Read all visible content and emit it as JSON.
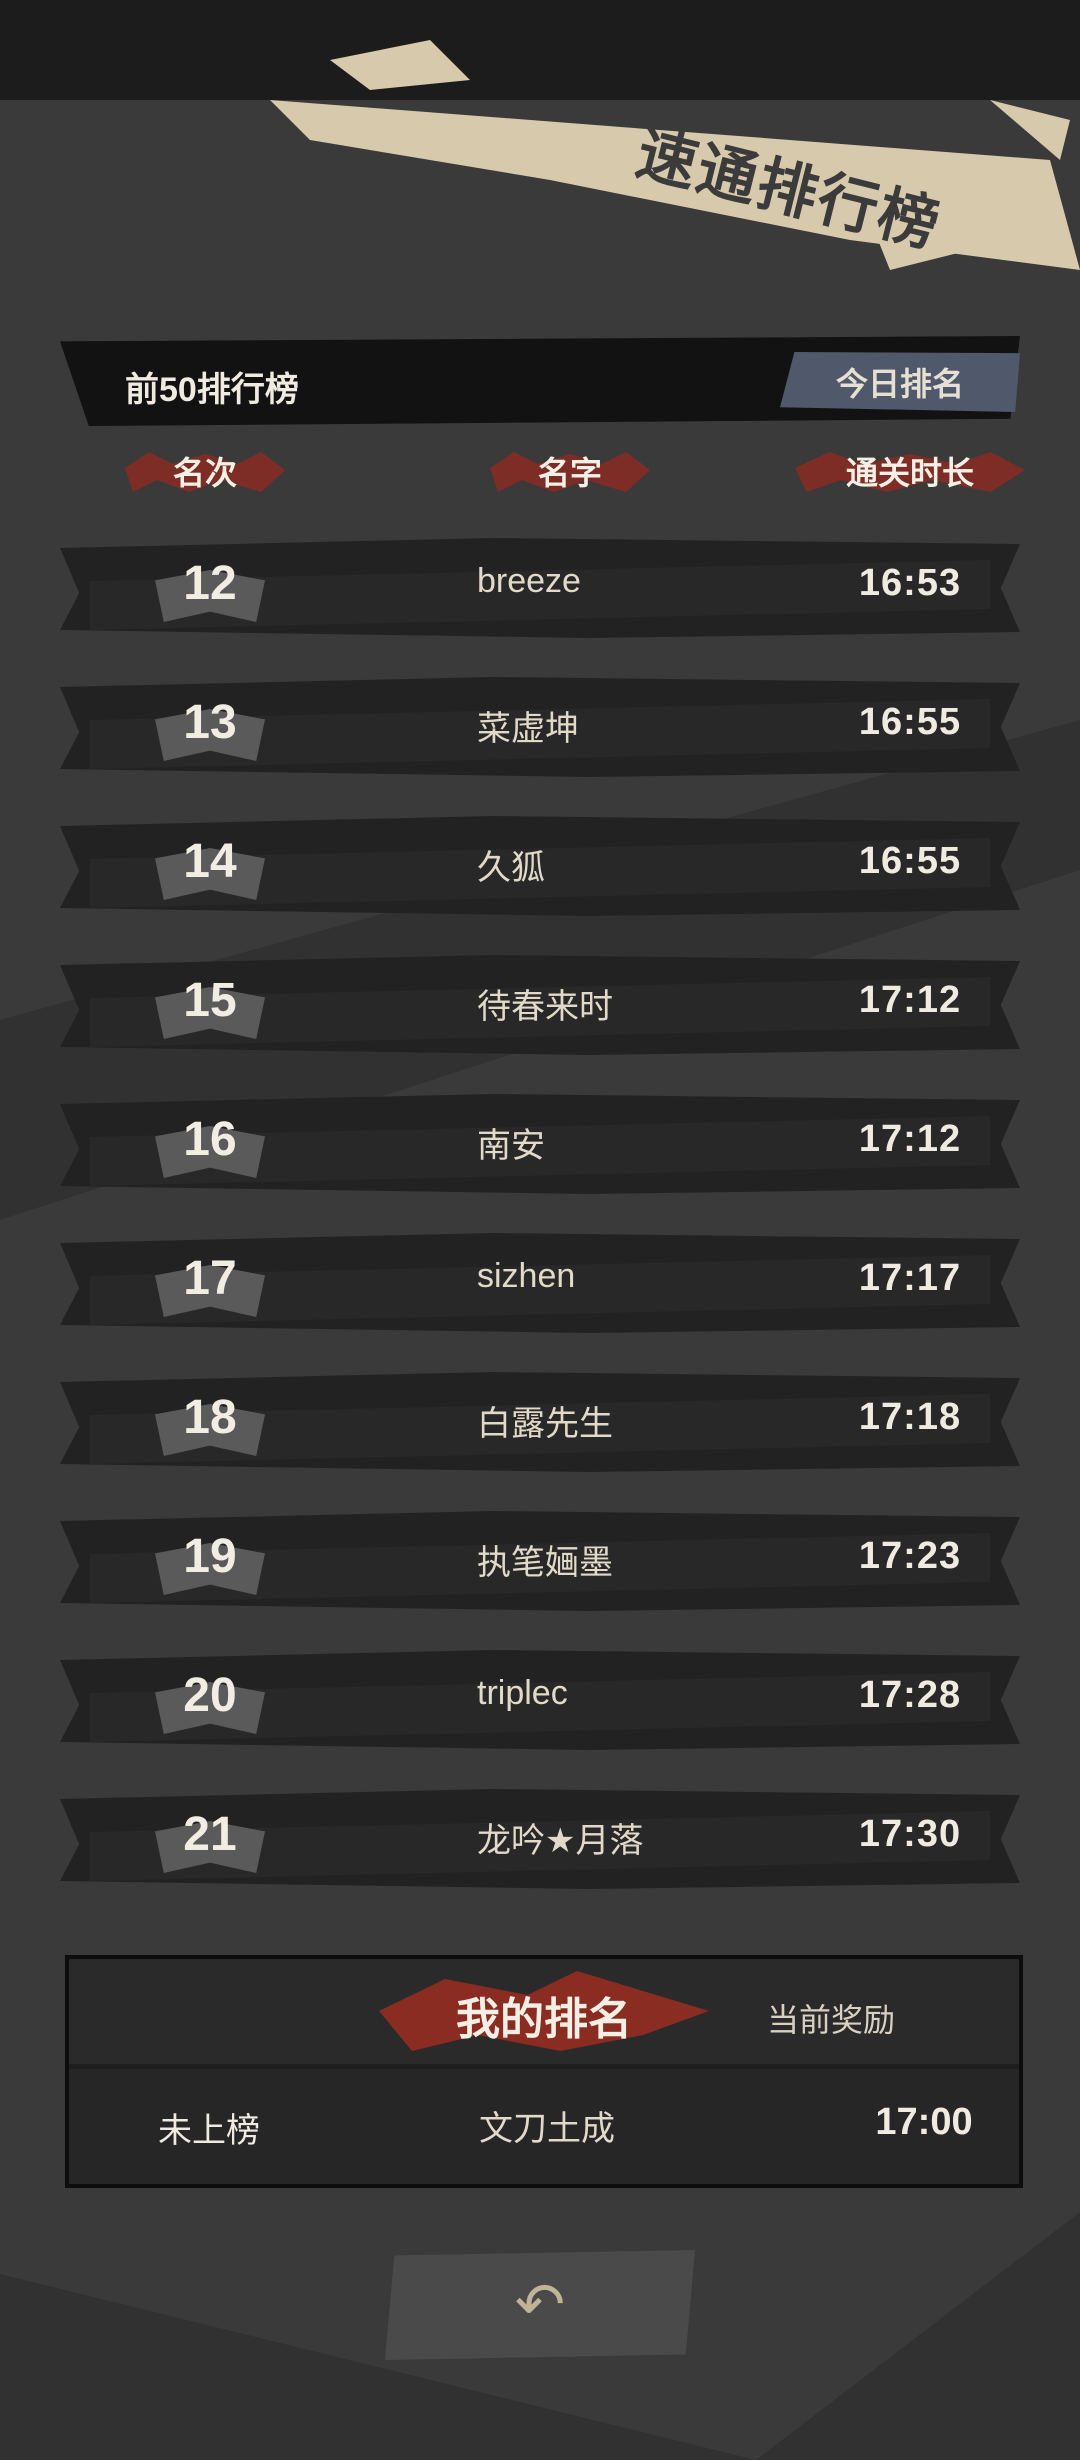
{
  "title": "速通排行榜",
  "subheader": {
    "title": "前50排行榜",
    "today_button": "今日排名"
  },
  "columns": {
    "rank": "名次",
    "name": "名字",
    "time": "通关时长"
  },
  "rows": [
    {
      "rank": "12",
      "name": "breeze",
      "time": "16:53"
    },
    {
      "rank": "13",
      "name": "菜虚坤",
      "time": "16:55"
    },
    {
      "rank": "14",
      "name": "久狐",
      "time": "16:55"
    },
    {
      "rank": "15",
      "name": "待春来时",
      "time": "17:12"
    },
    {
      "rank": "16",
      "name": "南安",
      "time": "17:12"
    },
    {
      "rank": "17",
      "name": "sizhen",
      "time": "17:17"
    },
    {
      "rank": "18",
      "name": "白露先生",
      "time": "17:18"
    },
    {
      "rank": "19",
      "name": "执笔婳墨",
      "time": "17:23"
    },
    {
      "rank": "20",
      "name": "triplec",
      "time": "17:28"
    },
    {
      "rank": "21",
      "name": "龙吟★月落",
      "time": "17:30"
    }
  ],
  "my_rank": {
    "title": "我的排名",
    "reward_link": "当前奖励",
    "rank": "未上榜",
    "name": "文刀土成",
    "time": "17:00"
  },
  "back_button": {
    "icon": "back-arrow-icon"
  },
  "colors": {
    "accent_red": "#8a2c22",
    "button_slate": "#50586c",
    "text_cream": "#f0ebe0"
  }
}
